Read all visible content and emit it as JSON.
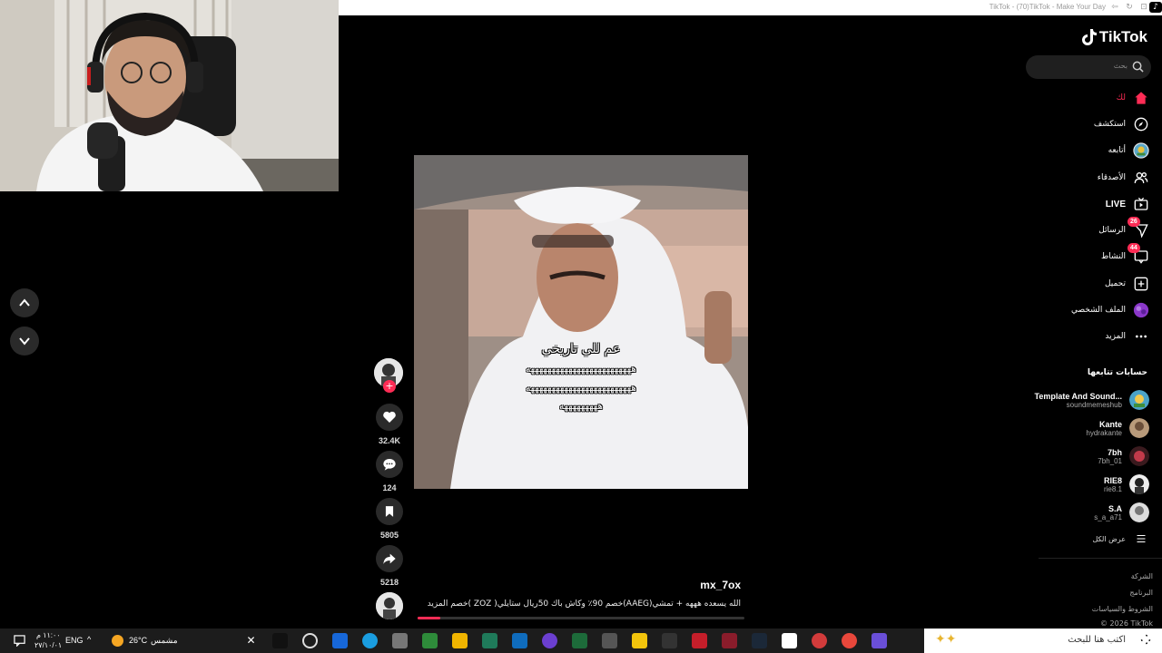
{
  "window": {
    "title": "TikTok - (70)TikTok - Make Your Day"
  },
  "video": {
    "caption_line1": "عم للي تاريخي",
    "caption_line2": "هههههههههههههههههههههههههه",
    "caption_line3": "هههههههههههههههههههههههههه",
    "caption_line4": "هههههههههه",
    "author": "mx_7ox",
    "description": "الله يسعده هههه + تمشي(AAEG)خصم 90٪ وكاش باك 50ريال  ستايلي( ZOZ )خصم   المزيد",
    "progress": 0.07
  },
  "actions": {
    "likes": "32.4K",
    "comments": "124",
    "saves": "5805",
    "shares": "5218"
  },
  "sidebar": {
    "logo": "TikTok",
    "search_placeholder": "بحث",
    "nav": {
      "foryou": "لك",
      "explore": "استكشف",
      "following": "أتابعه",
      "friends": "الأصدقاء",
      "live": "LIVE",
      "messages": "الرسائل",
      "messages_badge": "26",
      "activity": "النشاط",
      "activity_badge": "44",
      "upload": "تحميل",
      "profile": "الملف الشخصي",
      "more": "المزيد"
    },
    "following_title": "حسابات تتابعها",
    "accounts": [
      {
        "name": "Template And Sound...",
        "handle": "soundmemeshub"
      },
      {
        "name": "Kante",
        "handle": "hydrakante"
      },
      {
        "name": "7bh",
        "handle": "7bh_01"
      },
      {
        "name": "RIE8",
        "handle": "rie8.1"
      },
      {
        "name": "S.A",
        "handle": "s_a_a71"
      }
    ],
    "see_all": "عرض الكل",
    "footer": {
      "company": "الشركة",
      "program": "البرنامج",
      "terms": "الشروط والسياسات",
      "copyright": "© 2026 TikTok"
    }
  },
  "taskbar": {
    "search_placeholder": "اكتب هنا للبحث",
    "weather_label": "مشمس",
    "temperature": "26°C",
    "language": "ENG",
    "time": "١١:٠٠ م",
    "date": "٢٧/١٠/٠١"
  },
  "colors": {
    "accent": "#fe2c55",
    "background": "#000000"
  }
}
